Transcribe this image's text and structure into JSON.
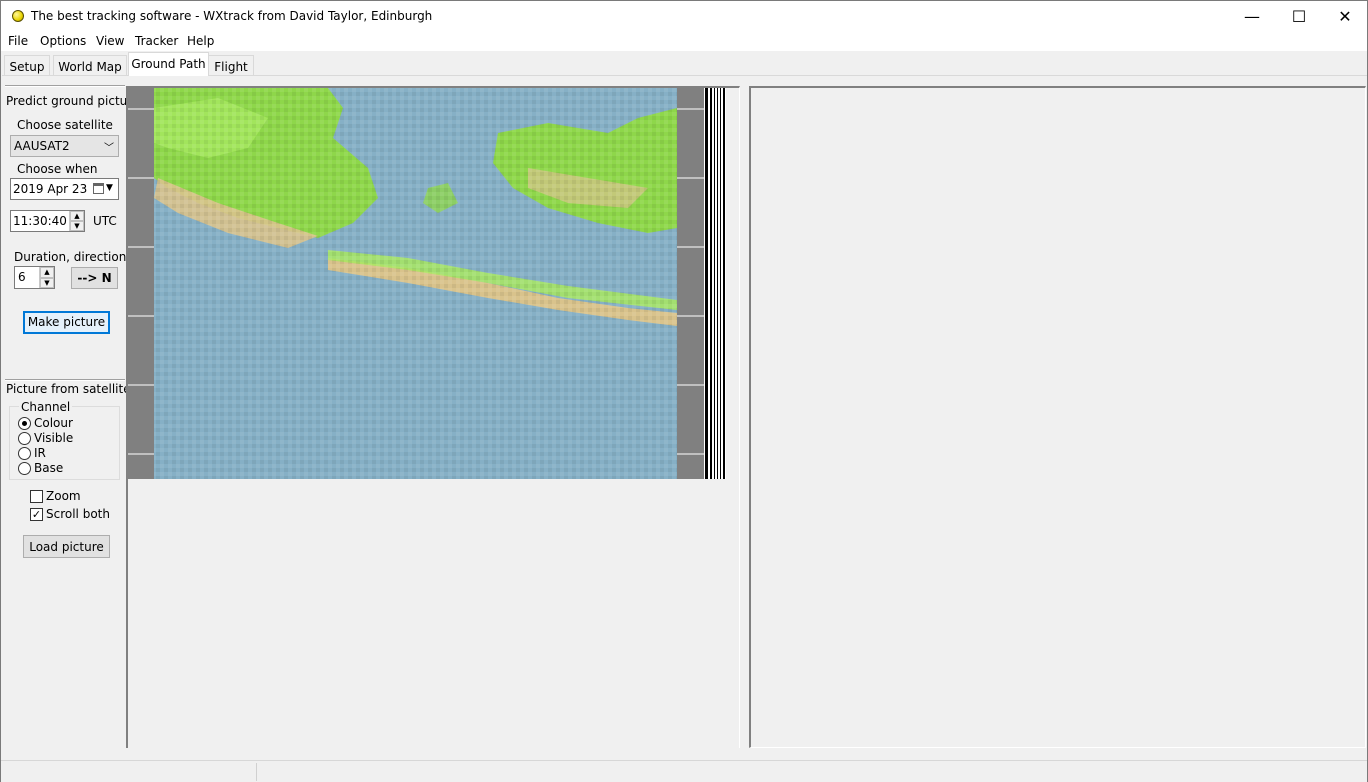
{
  "window": {
    "title": "The best tracking software - WXtrack from David Taylor, Edinburgh",
    "minimize": "—",
    "maximize": "☐",
    "close": "✕"
  },
  "menu": [
    "File",
    "Options",
    "View",
    "Tracker",
    "Help"
  ],
  "tabs": [
    {
      "label": "Setup",
      "active": false
    },
    {
      "label": "World Map",
      "active": false
    },
    {
      "label": "Ground Path",
      "active": true
    },
    {
      "label": "Flight",
      "active": false
    }
  ],
  "predict": {
    "section_title": "Predict ground picture",
    "choose_satellite_label": "Choose satellite",
    "satellite_value": "AAUSAT2",
    "choose_when_label": "Choose when",
    "date_value": "2019  Apr  23",
    "time_value": "11:30:40",
    "time_zone": "UTC",
    "duration_label": "Duration, direction",
    "duration_value": "6",
    "direction_button": "--> N",
    "make_picture_button": "Make picture"
  },
  "from_satellite": {
    "section_title": "Picture from satellite",
    "channel_group": "Channel",
    "channels": [
      {
        "label": "Colour",
        "checked": true
      },
      {
        "label": "Visible",
        "checked": false
      },
      {
        "label": "IR",
        "checked": false
      },
      {
        "label": "Base",
        "checked": false
      }
    ],
    "zoom_label": "Zoom",
    "zoom_checked": false,
    "scroll_both_label": "Scroll both",
    "scroll_both_checked": true,
    "load_picture_button": "Load picture"
  },
  "icons": {
    "app": "yellow-globe-icon",
    "dropdown": "chevron-down-icon",
    "calendar": "calendar-icon"
  },
  "colors": {
    "accent": "#0078d7",
    "ocean": "#86b0c6",
    "land_green": "#8fdc3c",
    "coast_tan": "#d9c38c",
    "frame_gray": "#808080"
  }
}
